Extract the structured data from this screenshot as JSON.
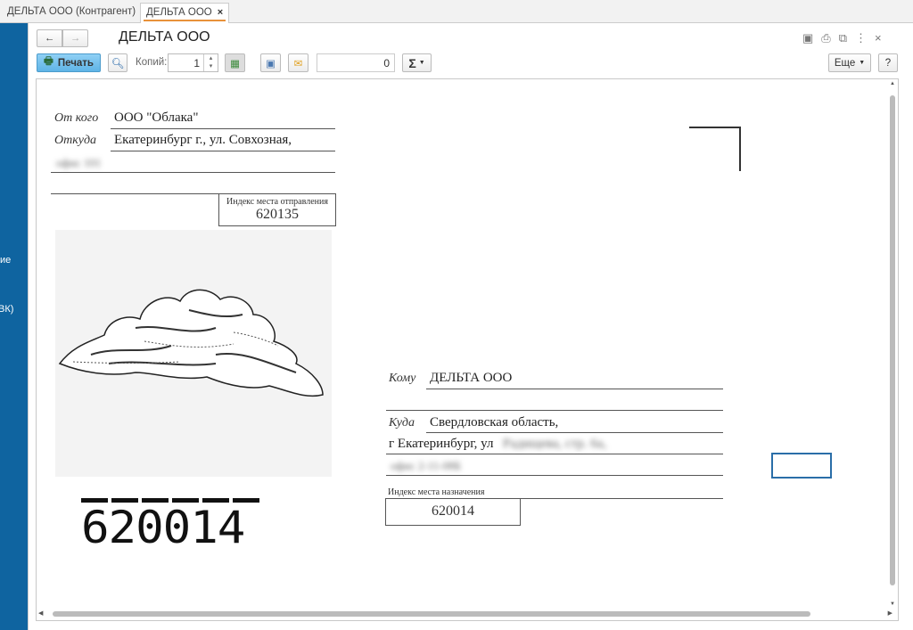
{
  "tabs": [
    {
      "label": "ДЕЛЬТА ООО (Контрагент)",
      "close": "×"
    },
    {
      "label": "ДЕЛЬТА ООО",
      "close": "×"
    }
  ],
  "sidebar": {
    "items": [
      "ие",
      "ВК)"
    ]
  },
  "header": {
    "title": "ДЕЛЬТА ООО",
    "back": "←",
    "forward": "→"
  },
  "toolbar": {
    "print_label": "Печать",
    "copies_label": "Копий:",
    "copies_value": "1",
    "sum_value": "0",
    "sigma": "Σ",
    "more_label": "Еще",
    "help_label": "?",
    "close": "×",
    "kebab": "⋮"
  },
  "envelope": {
    "from_label": "От кого",
    "from_value": "ООО \"Облака\"",
    "from_addr_label": "Откуда",
    "from_addr_line1": "Екатеринбург г., ул. Совхозная,",
    "from_addr_line2": "офис 101",
    "from_index_label": "Индекс места отправления",
    "from_index": "620135",
    "to_label": "Кому",
    "to_value": "ДЕЛЬТА ООО",
    "to_addr_label": "Куда",
    "to_addr_line1": "Свердловская область,",
    "to_addr_line2a": "г Екатеринбург, ул",
    "to_addr_line2b": "Радищева, стр. 6а,",
    "to_addr_line3": "офис 2-11-08Б",
    "to_index_label": "Индекс места назначения",
    "to_index": "620014",
    "postal_code_digits": "620014"
  }
}
